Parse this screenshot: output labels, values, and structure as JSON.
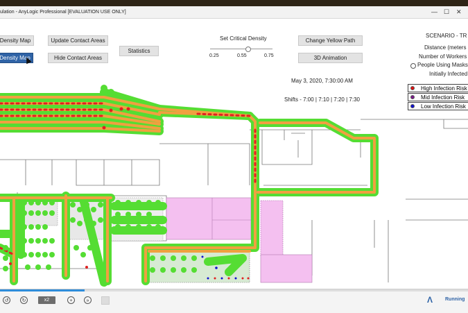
{
  "window": {
    "title": "ulation - AnyLogic Professional [EVALUATION USE ONLY]"
  },
  "buttons": {
    "density_map": "Density Map",
    "density_map_selected": "Density Map",
    "update_contact_areas": "Update Contact Areas",
    "hide_contact_areas": "Hide Contact Areas",
    "statistics": "Statistics",
    "change_yellow_path": "Change Yellow Path",
    "animation_3d": "3D Animation"
  },
  "critical_density": {
    "label": "Set Critical Density",
    "min": "0.25",
    "mid": "0.55",
    "max": "0.75",
    "value": 0.55
  },
  "datetime": "May 3, 2020, 7:30:00 AM",
  "shifts": "Shifts - 7:00 | 7:10 | 7:20 | 7:30",
  "scenario": {
    "title": "SCENARIO - TR",
    "distance": "Distance (meters",
    "workers": "Number of Workers",
    "masks": "People Using Masks",
    "infected": "Initially Infected"
  },
  "legend": {
    "high": {
      "label": "High Infection Risk",
      "color": "#e01010"
    },
    "mid": {
      "label": "Mid Infection Risk",
      "color": "#7a1a8a"
    },
    "low": {
      "label": "Low Infection Risk",
      "color": "#1010d0"
    }
  },
  "controls": {
    "speed": "x2",
    "status": "Running",
    "progress": 0.18
  },
  "colors": {
    "path_green": "#55dd33",
    "path_orange": "#f0a040",
    "risk_red": "#e02020",
    "pink_area": "#f4c0f0",
    "accent": "#2f63a6"
  }
}
